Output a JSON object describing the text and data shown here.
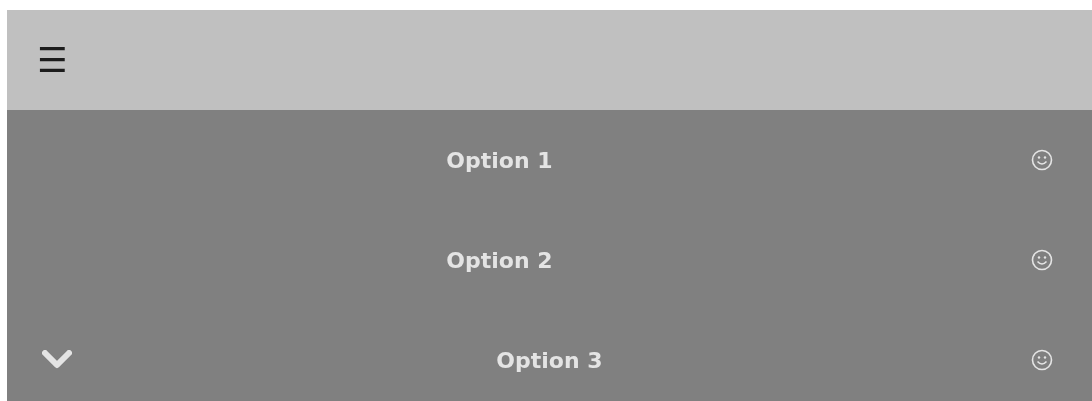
{
  "header": {
    "menu_icon": "☰"
  },
  "menu": {
    "items": [
      {
        "label": "Option 1",
        "kind": "plain"
      },
      {
        "label": "Option 2",
        "kind": "plain"
      },
      {
        "label": "Option 3",
        "kind": "submenu"
      }
    ]
  }
}
